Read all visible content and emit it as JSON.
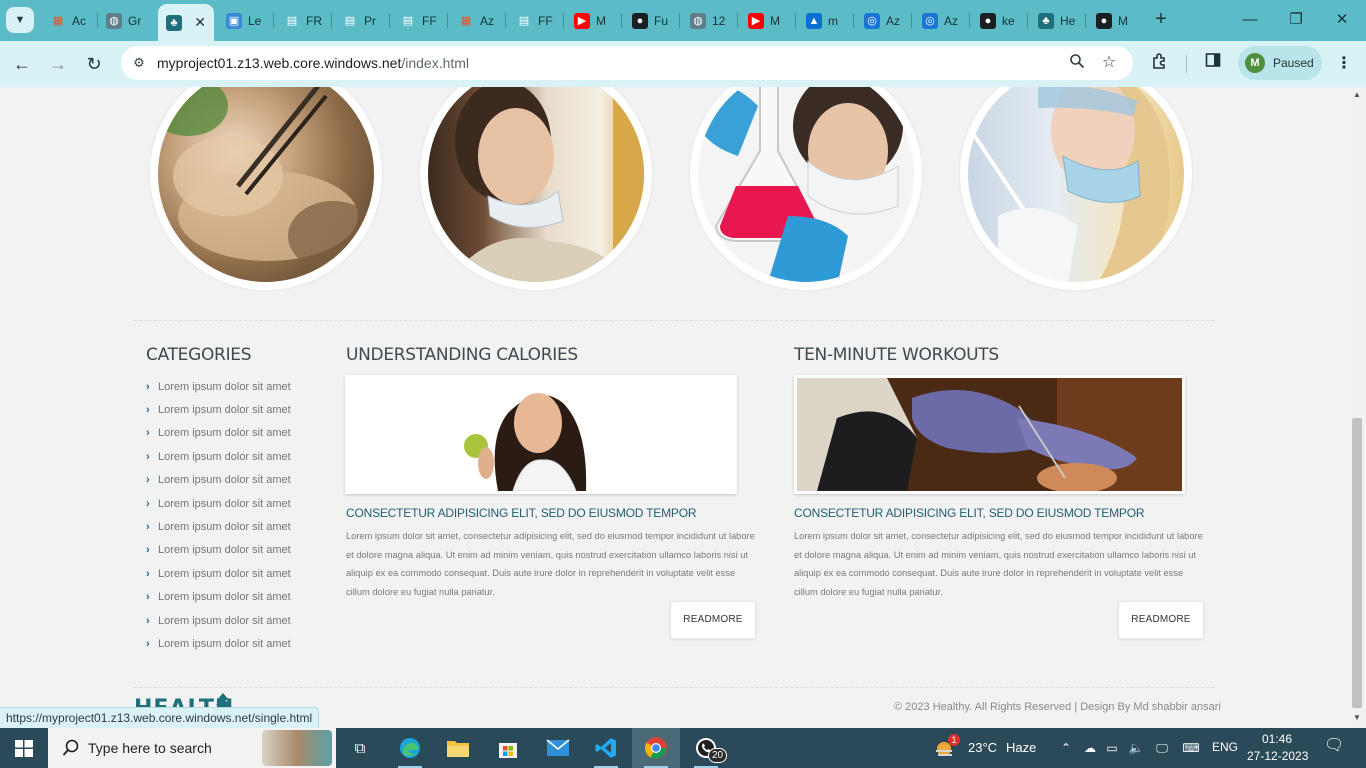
{
  "browser": {
    "tabs": [
      {
        "icon": "microsoft-icon",
        "title": "Ac",
        "active": false
      },
      {
        "icon": "globe-icon",
        "title": "Gr",
        "active": false
      },
      {
        "icon": "tree-icon",
        "title": "",
        "active": true
      },
      {
        "icon": "image-icon",
        "title": "Le",
        "active": false
      },
      {
        "icon": "doc-icon",
        "title": "FR",
        "active": false
      },
      {
        "icon": "doc-icon",
        "title": "Pr",
        "active": false
      },
      {
        "icon": "doc-icon",
        "title": "FF",
        "active": false
      },
      {
        "icon": "microsoft-icon",
        "title": "Az",
        "active": false
      },
      {
        "icon": "doc-icon",
        "title": "FF",
        "active": false
      },
      {
        "icon": "youtube-icon",
        "title": "M",
        "active": false
      },
      {
        "icon": "github-icon",
        "title": "Fu",
        "active": false
      },
      {
        "icon": "globe-icon",
        "title": "12",
        "active": false
      },
      {
        "icon": "youtube-icon",
        "title": "M",
        "active": false
      },
      {
        "icon": "azure-icon",
        "title": "m",
        "active": false
      },
      {
        "icon": "azure-devops-icon",
        "title": "Az",
        "active": false
      },
      {
        "icon": "azure-devops-icon",
        "title": "Az",
        "active": false
      },
      {
        "icon": "github-icon",
        "title": "ke",
        "active": false
      },
      {
        "icon": "tree-icon",
        "title": "He",
        "active": false
      },
      {
        "icon": "github-icon",
        "title": "M",
        "active": false
      }
    ],
    "url_host": "myproject01.z13.web.core.windows.net",
    "url_path": "/index.html",
    "profile_initial": "M",
    "profile_status": "Paused",
    "status_url": "https://myproject01.z13.web.core.windows.net/single.html"
  },
  "page": {
    "gallery": [
      "tweezers-photo",
      "woman-portrait-photo",
      "lab-flask-photo",
      "lab-pipette-photo"
    ],
    "categories_title": "CATEGORIES",
    "categories": [
      "Lorem ipsum dolor sit amet",
      "Lorem ipsum dolor sit amet",
      "Lorem ipsum dolor sit amet",
      "Lorem ipsum dolor sit amet",
      "Lorem ipsum dolor sit amet",
      "Lorem ipsum dolor sit amet",
      "Lorem ipsum dolor sit amet",
      "Lorem ipsum dolor sit amet",
      "Lorem ipsum dolor sit amet",
      "Lorem ipsum dolor sit amet",
      "Lorem ipsum dolor sit amet",
      "Lorem ipsum dolor sit amet"
    ],
    "articles": [
      {
        "title": "UNDERSTANDING CALORIES",
        "subtitle": "CONSECTETUR ADIPISICING ELIT, SED DO EIUSMOD TEMPOR",
        "body": "Lorem ipsum dolor sit amet, consectetur adipisicing elit, sed do eiusmod tempor incididunt ut labore et dolore magna aliqua. Ut enim ad minim veniam, quis nostrud exercitation ullamco laboris nisi ut aliquip ex ea commodo consequat. Duis aute irure dolor in reprehenderit in voluptate velit esse cillum dolore eu fugiat nulla pariatur.",
        "button": "READMORE"
      },
      {
        "title": "TEN-MINUTE WORKOUTS",
        "subtitle": "CONSECTETUR ADIPISICING ELIT, SED DO EIUSMOD TEMPOR",
        "body": "Lorem ipsum dolor sit amet, consectetur adipisicing elit, sed do eiusmod tempor incididunt ut labore et dolore magna aliqua. Ut enim ad minim veniam, quis nostrud exercitation ullamco laboris nisi ut aliquip ex ea commodo consequat. Duis aute irure dolor in reprehenderit in voluptate velit esse cillum dolore eu fugiat nulla pariatur.",
        "button": "READMORE"
      }
    ],
    "footer": {
      "logo_text": "HEALTH",
      "copyright": "© 2023 Healthy. All Rights Reserved | Design By Md shabbir ansari"
    }
  },
  "taskbar": {
    "search_placeholder": "Type here to search",
    "apps": [
      "task-view-icon",
      "edge-icon",
      "file-explorer-icon",
      "store-icon",
      "mail-icon",
      "vscode-icon",
      "chrome-icon",
      "whatsapp-icon"
    ],
    "whatsapp_badge": "20",
    "weather_badge": "1",
    "temperature": "23°C",
    "weather": "Haze",
    "language": "ENG",
    "time": "01:46",
    "date": "27-12-2023"
  },
  "colors": {
    "tabstrip": "#5bbcc7",
    "toolbar": "#d9f2f5",
    "accent_teal": "#1f5f6e",
    "taskbar": "#2b4a59"
  }
}
